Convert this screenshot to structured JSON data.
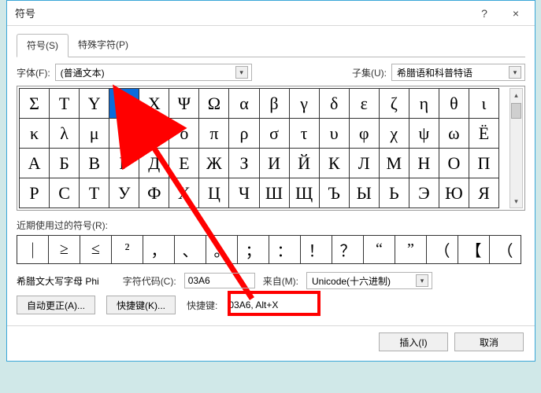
{
  "window": {
    "title": "符号",
    "help": "?",
    "close": "×"
  },
  "tabs": {
    "symbols": "符号(S)",
    "special": "特殊字符(P)"
  },
  "font_row": {
    "font_label": "字体(F):",
    "font_value": "(普通文本)",
    "subset_label": "子集(U):",
    "subset_value": "希腊语和科普特语"
  },
  "grid": {
    "rows": [
      [
        "Σ",
        "Τ",
        "Υ",
        "Φ",
        "Χ",
        "Ψ",
        "Ω",
        "α",
        "β",
        "γ",
        "δ",
        "ε",
        "ζ",
        "η",
        "θ",
        "ι"
      ],
      [
        "κ",
        "λ",
        "μ",
        "ν",
        "ξ",
        "ο",
        "π",
        "ρ",
        "σ",
        "τ",
        "υ",
        "φ",
        "χ",
        "ψ",
        "ω",
        "Ё"
      ],
      [
        "А",
        "Б",
        "В",
        "Г",
        "Д",
        "Е",
        "Ж",
        "З",
        "И",
        "Й",
        "К",
        "Л",
        "М",
        "Н",
        "О",
        "П"
      ],
      [
        "Р",
        "С",
        "Т",
        "У",
        "Ф",
        "Х",
        "Ц",
        "Ч",
        "Ш",
        "Щ",
        "Ъ",
        "Ы",
        "Ь",
        "Э",
        "Ю",
        "Я"
      ]
    ],
    "selected": {
      "row": 0,
      "col": 3
    }
  },
  "recent": {
    "label": "近期使用过的符号(R):",
    "cells": [
      "｜",
      "≥",
      "≤",
      "²",
      "，",
      "、",
      "。",
      "；",
      "：",
      "！",
      "？",
      "“",
      "”",
      "（",
      "【",
      "（"
    ]
  },
  "info": {
    "charname": "希腊文大写字母 Phi",
    "code_label": "字符代码(C):",
    "code_value": "03A6",
    "from_label": "来自(M):",
    "from_value": "Unicode(十六进制)"
  },
  "buttons": {
    "autocorrect": "自动更正(A)...",
    "shortcut_btn": "快捷键(K)...",
    "shortcut_label": "快捷键:",
    "shortcut_value": "03A6, Alt+X",
    "insert": "插入(I)",
    "cancel": "取消"
  }
}
